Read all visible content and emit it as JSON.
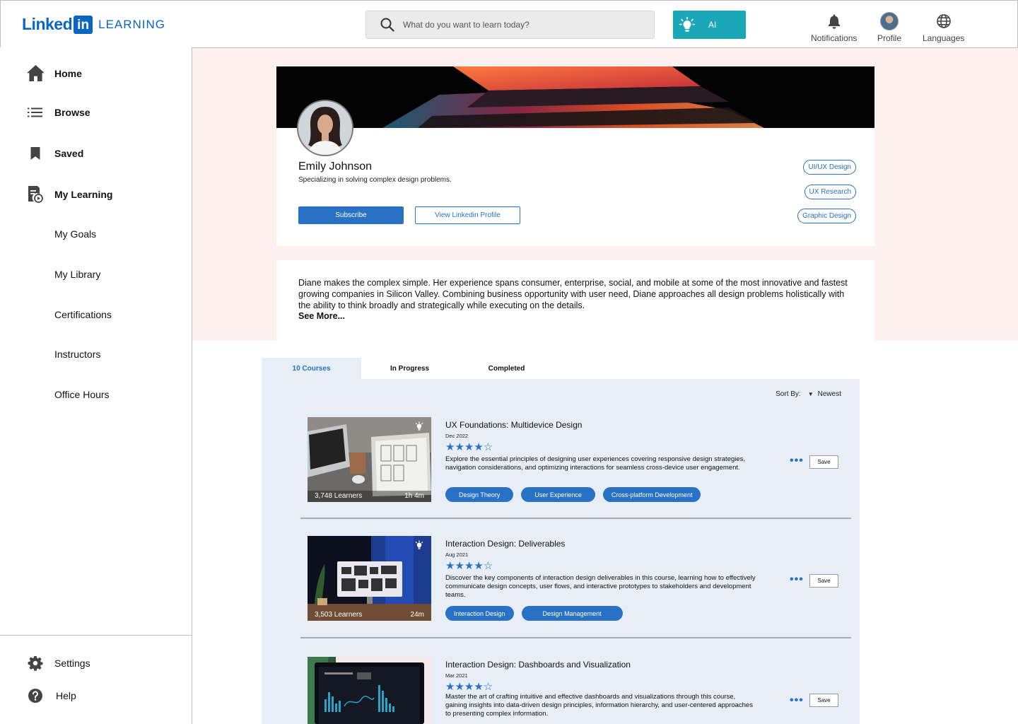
{
  "header": {
    "logo_linked": "Linked",
    "logo_in": "in",
    "logo_learning": "LEARNING",
    "search_placeholder": "What do you want to learn today?",
    "ai_label": "AI",
    "nav": [
      {
        "label": "Notifications",
        "icon": "bell-icon"
      },
      {
        "label": "Profile",
        "icon": "avatar"
      },
      {
        "label": "Languages",
        "icon": "globe-icon"
      }
    ]
  },
  "sidebar": {
    "items": [
      {
        "label": "Home",
        "icon": "home-icon"
      },
      {
        "label": "Browse",
        "icon": "list-icon"
      },
      {
        "label": "Saved",
        "icon": "bookmark-icon"
      },
      {
        "label": "My Learning",
        "icon": "my-learning-icon"
      }
    ],
    "subitems": [
      "My Goals",
      "My Library",
      "Certifications",
      "Instructors",
      "Office Hours"
    ],
    "footer": [
      {
        "label": "Settings",
        "icon": "gear-icon"
      },
      {
        "label": "Help",
        "icon": "help-icon"
      }
    ]
  },
  "profile": {
    "name": "Emily Johnson",
    "tagline": "Specializing in solving complex design problems.",
    "subscribe_label": "Subscribe",
    "linkedin_label": "View Linkedin Profile",
    "skills": [
      "UI/UX Design",
      "UX Research",
      "Graphic Design"
    ]
  },
  "bio": {
    "text": "Diane makes the complex simple. Her experience spans consumer, enterprise, social, and mobile at some of the most innovative and fastest growing companies in Silicon Valley. Combining business opportunity with user need, Diane approaches all design problems holistically with the ability to think broadly and strategically while executing on the details.",
    "see_more": "See More..."
  },
  "tabs": [
    "10 Courses",
    "In Progress",
    "Completed"
  ],
  "sort": {
    "label": "Sort By:",
    "value": "Newest"
  },
  "courses": [
    {
      "title": "UX Foundations: Multidevice Design",
      "date": "Dec 2022",
      "rating": 4,
      "stars": "★★★★☆",
      "description": "Explore the essential principles of designing user experiences covering responsive design strategies, navigation considerations, and optimizing interactions for seamless cross-device user engagement.",
      "learners": "3,748 Learners",
      "duration": "1h 4m",
      "tags": [
        "Design Theory",
        "User Experience",
        "Cross-platform Development"
      ],
      "more": "•••",
      "save": "Save"
    },
    {
      "title": "Interaction Design: Deliverables",
      "date": "Aug 2021",
      "rating": 4,
      "stars": "★★★★☆",
      "description": "Discover the key components of interaction design deliverables in this course, learning how to effectively communicate design concepts, user flows, and interactive prototypes to stakeholders and development teams.",
      "learners": "3,503 Learners",
      "duration": "24m",
      "tags": [
        "Interaction Design",
        "Design Management"
      ],
      "more": "•••",
      "save": "Save"
    },
    {
      "title": "Interaction Design: Dashboards and Visualization",
      "date": "Mar 2021",
      "rating": 4,
      "stars": "★★★★☆",
      "description": "Master the art of crafting intuitive and effective dashboards and visualizations through this course, gaining insights into data-driven design principles, information hierarchy, and user-centered approaches to presenting complex information.",
      "more": "•••",
      "save": "Save"
    }
  ],
  "colors": {
    "brand": "#0a66c2",
    "accent": "#2871c4",
    "ai": "#1aa7b8",
    "pink_bg": "#fdf1f0",
    "panel_bg": "#e8eef6"
  }
}
